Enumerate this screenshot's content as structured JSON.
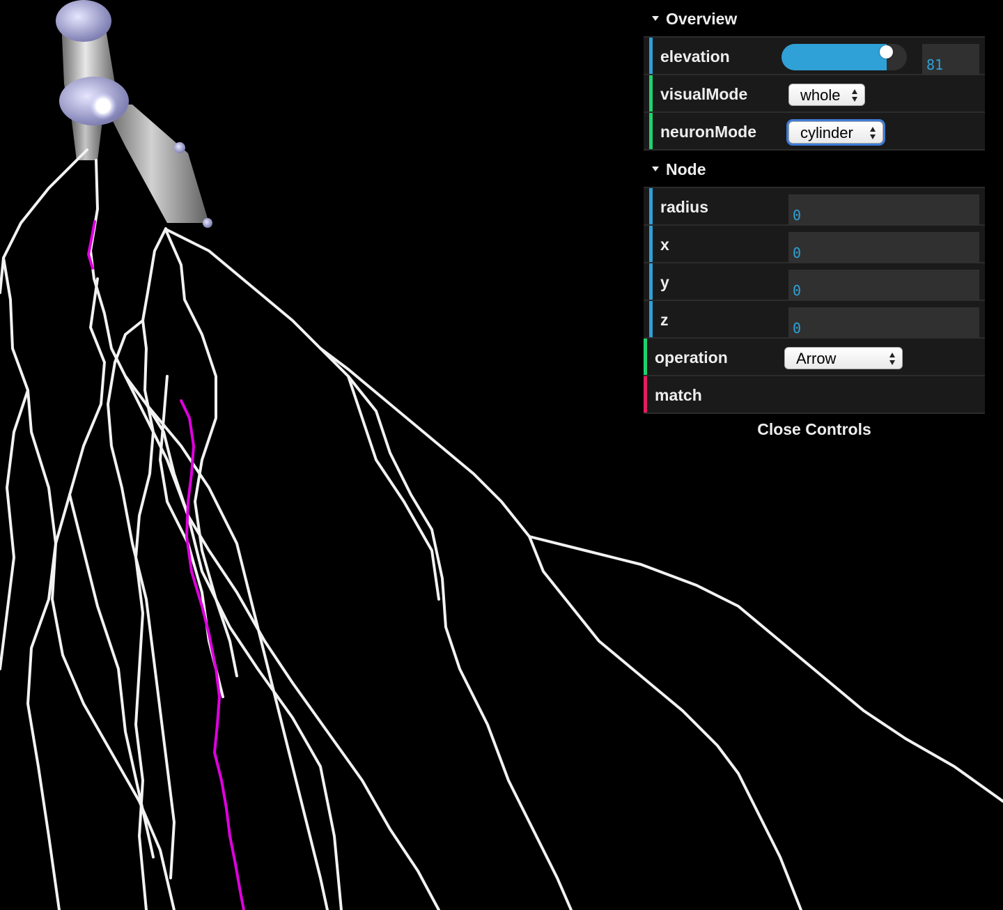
{
  "gui": {
    "overview": {
      "title": "Overview",
      "elevation": {
        "label": "elevation",
        "value": "81",
        "fill_fraction": 0.84
      },
      "visualMode": {
        "label": "visualMode",
        "selected": "whole"
      },
      "neuronMode": {
        "label": "neuronMode",
        "selected": "cylinder"
      }
    },
    "node": {
      "title": "Node",
      "radius": {
        "label": "radius",
        "value": "0"
      },
      "x": {
        "label": "x",
        "value": "0"
      },
      "y": {
        "label": "y",
        "value": "0"
      },
      "z": {
        "label": "z",
        "value": "0"
      }
    },
    "operation": {
      "label": "operation",
      "selected": "Arrow"
    },
    "match": {
      "label": "match"
    },
    "close_label": "Close Controls"
  },
  "colors": {
    "background": "#000000",
    "number_accent": "#2fa1d6",
    "folder_bar_number": "#2fa1d6",
    "folder_bar_select": "#1ed36f",
    "folder_bar_function": "#e61d5f",
    "neuron_branch": "#ffffff",
    "selected_branch": "#e000e0",
    "soma_node": "#b8b8e8"
  },
  "scene": {
    "description_icon": "neuron-3d-view"
  }
}
